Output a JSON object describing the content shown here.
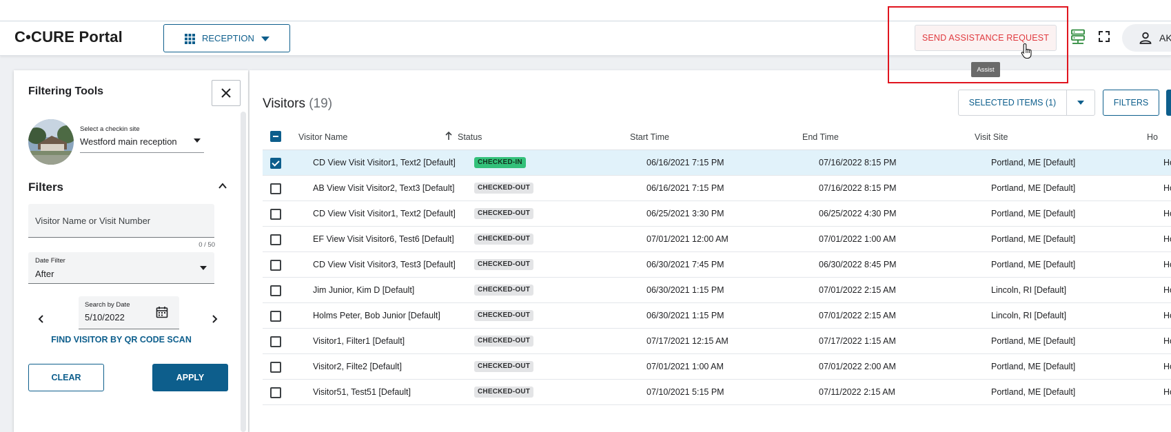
{
  "app": {
    "brand": "C•CURE Portal",
    "module_label": "RECEPTION",
    "assist_label": "SEND ASSISTANCE REQUEST",
    "assist_tooltip": "Assist",
    "user_initials": "AK"
  },
  "filter_panel": {
    "title": "Filtering Tools",
    "site_label": "Select a checkin site",
    "site_value": "Westford main reception",
    "filters_heading": "Filters",
    "search_placeholder": "Visitor Name or Visit Number",
    "search_counter": "0 / 50",
    "date_filter_label": "Date Filter",
    "date_filter_value": "After",
    "search_date_label": "Search by Date",
    "search_date_value": "5/10/2022",
    "qr_link": "FIND VISITOR BY QR CODE SCAN",
    "clear_label": "CLEAR",
    "apply_label": "APPLY"
  },
  "main": {
    "title": "Visitors",
    "count": "(19)",
    "selected_label": "SELECTED ITEMS (1)",
    "filters_label": "FILTERS",
    "columns": {
      "name": "Visitor Name",
      "status": "Status",
      "start": "Start Time",
      "end": "End Time",
      "site": "Visit Site",
      "host": "Ho"
    },
    "rows": [
      {
        "name": "CD View Visit Visitor1, Text2 [Default]",
        "status": "CHECKED-IN",
        "start": "06/16/2021 7:15 PM",
        "end": "07/16/2022 8:15 PM",
        "site": "Portland, ME [Default]",
        "host": "Ho"
      },
      {
        "name": "AB View Visit Visitor2, Text3 [Default]",
        "status": "CHECKED-OUT",
        "start": "06/16/2021 7:15 PM",
        "end": "07/16/2022 8:15 PM",
        "site": "Portland, ME [Default]",
        "host": "Ho"
      },
      {
        "name": "CD View Visit Visitor1, Text2 [Default]",
        "status": "CHECKED-OUT",
        "start": "06/25/2021 3:30 PM",
        "end": "06/25/2022 4:30 PM",
        "site": "Portland, ME [Default]",
        "host": "Ho"
      },
      {
        "name": "EF View Visit Visitor6, Test6 [Default]",
        "status": "CHECKED-OUT",
        "start": "07/01/2021 12:00 AM",
        "end": "07/01/2022 1:00 AM",
        "site": "Portland, ME [Default]",
        "host": "Ho"
      },
      {
        "name": "CD View Visit Visitor3, Test3 [Default]",
        "status": "CHECKED-OUT",
        "start": "06/30/2021 7:45 PM",
        "end": "06/30/2022 8:45 PM",
        "site": "Portland, ME [Default]",
        "host": "Ho"
      },
      {
        "name": "Jim Junior, Kim D [Default]",
        "status": "CHECKED-OUT",
        "start": "06/30/2021 1:15 PM",
        "end": "07/01/2022 2:15 AM",
        "site": "Lincoln, RI [Default]",
        "host": "Ho"
      },
      {
        "name": "Holms Peter, Bob Junior [Default]",
        "status": "CHECKED-OUT",
        "start": "06/30/2021 1:15 PM",
        "end": "07/01/2022 2:15 AM",
        "site": "Lincoln, RI [Default]",
        "host": "Ho"
      },
      {
        "name": "Visitor1, Filter1 [Default]",
        "status": "CHECKED-OUT",
        "start": "07/17/2021 12:15 AM",
        "end": "07/17/2022 1:15 AM",
        "site": "Portland, ME [Default]",
        "host": "Ho"
      },
      {
        "name": "Visitor2, Filte2 [Default]",
        "status": "CHECKED-OUT",
        "start": "07/01/2021 1:00 AM",
        "end": "07/01/2022 2:00 AM",
        "site": "Portland, ME [Default]",
        "host": "Ho"
      },
      {
        "name": "Visitor51, Test51 [Default]",
        "status": "CHECKED-OUT",
        "start": "07/10/2021 5:15 PM",
        "end": "07/11/2022 2:15 AM",
        "site": "Portland, ME [Default]",
        "host": "Ho"
      }
    ]
  },
  "colors": {
    "accent": "#0d5e8c",
    "checked_in": "#33c17a",
    "alert": "#e0393e",
    "selected_row": "#e1f2fa"
  }
}
